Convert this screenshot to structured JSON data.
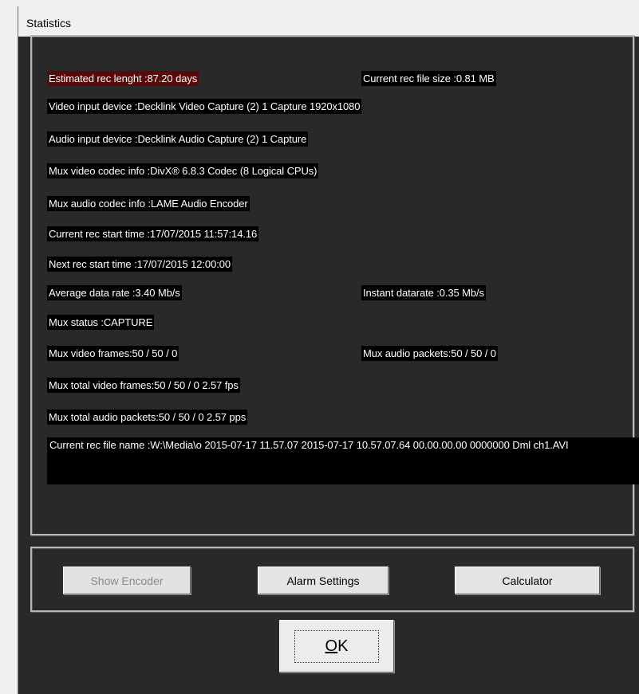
{
  "window": {
    "title": "Statistics"
  },
  "stats": {
    "estimated_rec_length": "Estimated rec lenght :87.20 days",
    "current_rec_file_size": "Current rec file size :0.81 MB",
    "video_input_device": "Video input device :Decklink Video Capture (2) 1 Capture 1920x1080",
    "audio_input_device": "Audio input device :Decklink Audio Capture (2) 1 Capture",
    "mux_video_codec": "Mux video codec info :DivX® 6.8.3 Codec (8 Logical CPUs)",
    "mux_audio_codec": "Mux audio codec info :LAME Audio Encoder",
    "current_rec_start_time": "Current rec start time :17/07/2015 11:57:14.16",
    "next_rec_start_time": "Next rec start time :17/07/2015 12:00:00",
    "average_data_rate": "Average data rate :3.40 Mb/s",
    "instant_datarate": "Instant datarate :0.35 Mb/s",
    "mux_status": "Mux status :CAPTURE",
    "mux_video_frames": "Mux video frames:50 / 50 / 0",
    "mux_audio_packets": "Mux audio packets:50 / 50 / 0",
    "mux_total_video_frames": "Mux total video frames:50 / 50 / 0 2.57 fps",
    "mux_total_audio_packets": "Mux total audio packets:50 / 50 / 0 2.57 pps",
    "current_rec_file_name": "Current rec file name :W:\\Media\\o 2015-07-17  11.57.07  2015-07-17  10.57.07.64  00.00.00.00  0000000  Dml ch1.AVI"
  },
  "buttons": {
    "show_encoder": "Show Encoder",
    "alarm_settings": "Alarm Settings",
    "calculator": "Calculator",
    "ok_mnemonic": "O",
    "ok_rest": "K"
  },
  "colors": {
    "panel_background": "#292929",
    "label_background": "#000000",
    "alert_background": "#5a0808"
  }
}
